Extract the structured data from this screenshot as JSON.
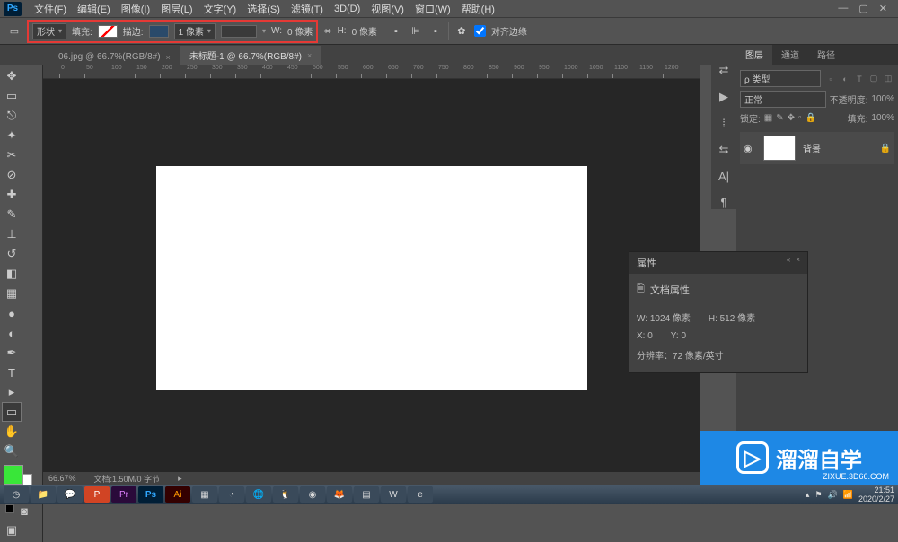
{
  "menubar": {
    "items": [
      "文件(F)",
      "编辑(E)",
      "图像(I)",
      "图层(L)",
      "文字(Y)",
      "选择(S)",
      "滤镜(T)",
      "3D(D)",
      "视图(V)",
      "窗口(W)",
      "帮助(H)"
    ]
  },
  "options": {
    "mode": "形状",
    "fill_label": "填充:",
    "stroke_label": "描边:",
    "stroke_width": "1 像素",
    "w_label": "W:",
    "w_val": "0 像素",
    "h_label": "H:",
    "h_val": "0 像素",
    "align_label": "对齐边缘"
  },
  "tabs": [
    {
      "label": "06.jpg @ 66.7%(RGB/8#)",
      "active": false
    },
    {
      "label": "未标题-1 @ 66.7%(RGB/8#)",
      "active": true
    }
  ],
  "layers_panel": {
    "tabs": [
      "图层",
      "通道",
      "路径"
    ],
    "kind_label": "ρ 类型",
    "blend_mode": "正常",
    "opacity_label": "不透明度:",
    "opacity_val": "100%",
    "lock_label": "锁定:",
    "fill_label": "填充:",
    "fill_val": "100%",
    "layer_name": "背景"
  },
  "props_panel": {
    "title": "属性",
    "doc_title": "文档属性",
    "w": "W:  1024 像素",
    "h": "H:  512 像素",
    "x": "X:  0",
    "y": "Y:  0",
    "res": "分辨率：72 像素/英寸"
  },
  "status": {
    "zoom": "66.67%",
    "info": "文档:1.50M/0 字节"
  },
  "watermark": {
    "text": "溜溜自学",
    "url": "ZIXUE.3D66.COM"
  },
  "taskbar": {
    "time": "21:51",
    "date": "2020/2/27"
  },
  "ruler_ticks": [
    0,
    50,
    100,
    150,
    200,
    250,
    300,
    350,
    400,
    450,
    500,
    550,
    600,
    650,
    700,
    750,
    800,
    850,
    900,
    950,
    1000,
    1050,
    1100,
    1150,
    1200
  ]
}
